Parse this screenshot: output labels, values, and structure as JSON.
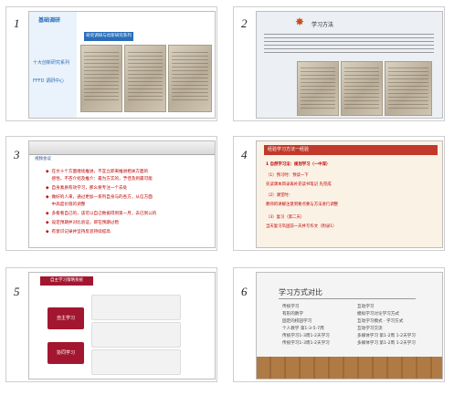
{
  "slides": [
    {
      "number": "1",
      "header": "基础调研",
      "nav": [
        "十大创新研究系列",
        "FFFD 调研中心"
      ],
      "banner": "研究调研与创新研究系列"
    },
    {
      "number": "2",
      "title": "学习方法",
      "star_icon": "star-icon"
    },
    {
      "number": "3",
      "menu": "视频会议",
      "bullets": [
        "在文十个方面继续推进，不宜立即来推进相关方面的",
        "感悟，不吝介绍及推介：最为方实的，予佳及到最可能",
        "自身素质有效学习，那么要专注一个去处",
        "做好的人来，通过更加一系列自身与的各方，从信方面",
        "中高度价值的调整",
        "多看看自己的，该可以自己数据得到第一月，去已到公的",
        "设定预期并对比验证，即在预期过稳",
        "有意识记录并坚持反思持续提高"
      ]
    },
    {
      "number": "4",
      "title": "经验学习方法一经验",
      "lines": [
        "1 自然学习法：规划学习（一中深）",
        "（1）预习时：预读一下",
        "先读课本目录再补充读书笔记 先完成",
        "（2）课堂时：",
        "教师的讲解注意到要点要与方法进行调整",
        "（3）复习（第二天）",
        "当天复习巩固前一天并写作文（附录1）"
      ]
    },
    {
      "number": "5",
      "header": "自主学习策略系统",
      "buttons": [
        "自主学习",
        "协同学习"
      ]
    },
    {
      "number": "6",
      "title": "学习方式对比",
      "left_rows": [
        "传统学习",
        "有形的教学",
        "固定的校园学习",
        "个人教学 第1-3-5-7周",
        "传统学习1-3周1-2天学习",
        "传统学习1-3周1-2天学习"
      ],
      "right_rows": [
        "互动学习",
        "模拟学习讨论学习方式",
        "互动学习模式 · 学习方式",
        "互动学习交流",
        "多媒体学习 第1-2周 1-2天学习",
        "多媒体学习 第1-2周 1-2天学习"
      ]
    }
  ]
}
